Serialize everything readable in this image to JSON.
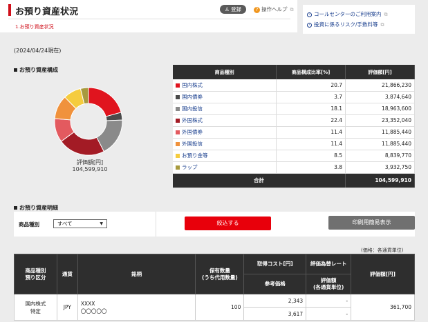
{
  "header": {
    "title": "お預り資産状況",
    "register_label": "登録",
    "help_label": "操作ヘルプ",
    "breadcrumb": "1.お預り資産状況"
  },
  "links": [
    {
      "label": "コールセンターのご利用案内"
    },
    {
      "label": "投資に係るリスク/手数料等"
    }
  ],
  "as_of": "(2024/04/24現在)",
  "composition": {
    "section_title": "お預り資産構成",
    "donut_caption": "評価額[円]",
    "donut_total": "104,599,910",
    "headers": {
      "category": "商品種別",
      "ratio": "商品構成比率[%]",
      "value": "評価額[円]"
    },
    "rows": [
      {
        "label": "国内株式",
        "ratio": "20.7",
        "value": "21,866,230",
        "color": "#e0141e"
      },
      {
        "label": "国内債券",
        "ratio": "3.7",
        "value": "3,874,640",
        "color": "#4a4a4a"
      },
      {
        "label": "国内投信",
        "ratio": "18.1",
        "value": "18,963,600",
        "color": "#8a8a8a"
      },
      {
        "label": "外国株式",
        "ratio": "22.4",
        "value": "23,352,040",
        "color": "#a31b25"
      },
      {
        "label": "外国債券",
        "ratio": "11.4",
        "value": "11,885,440",
        "color": "#e35a5f"
      },
      {
        "label": "外国投信",
        "ratio": "11.4",
        "value": "11,885,440",
        "color": "#f0923c"
      },
      {
        "label": "お預り金等",
        "ratio": "8.5",
        "value": "8,839,770",
        "color": "#f5cc3e"
      },
      {
        "label": "ラップ",
        "ratio": "3.8",
        "value": "3,932,750",
        "color": "#a89a3e"
      }
    ],
    "total_label": "合計",
    "total_value": "104,599,910"
  },
  "detail": {
    "section_title": "お預り資産明細",
    "filter_label": "商品種別",
    "filter_value": "すべて",
    "apply_label": "絞込する",
    "print_label": "印刷用簡易表示",
    "unit_note": "(価格：各通貨単位)",
    "headers": {
      "type": "商品種別\n預り区分",
      "currency": "通貨",
      "name": "銘柄",
      "qty": "保有数量\n(うち代用数量)",
      "cost": "取得コスト[円]",
      "rate": "評価為替レート",
      "ref_price": "参考価格",
      "val_local": "評価額\n(各通貨単位)",
      "value": "評価額[円]"
    },
    "rows": [
      {
        "type": "国内株式\n特定",
        "currency": "JPY",
        "name": "XXXX\n〇〇〇〇〇",
        "qty": "100",
        "cost": "2,343",
        "rate": "-",
        "ref_price": "3,617",
        "val_local": "-",
        "value": "361,700"
      }
    ]
  }
}
